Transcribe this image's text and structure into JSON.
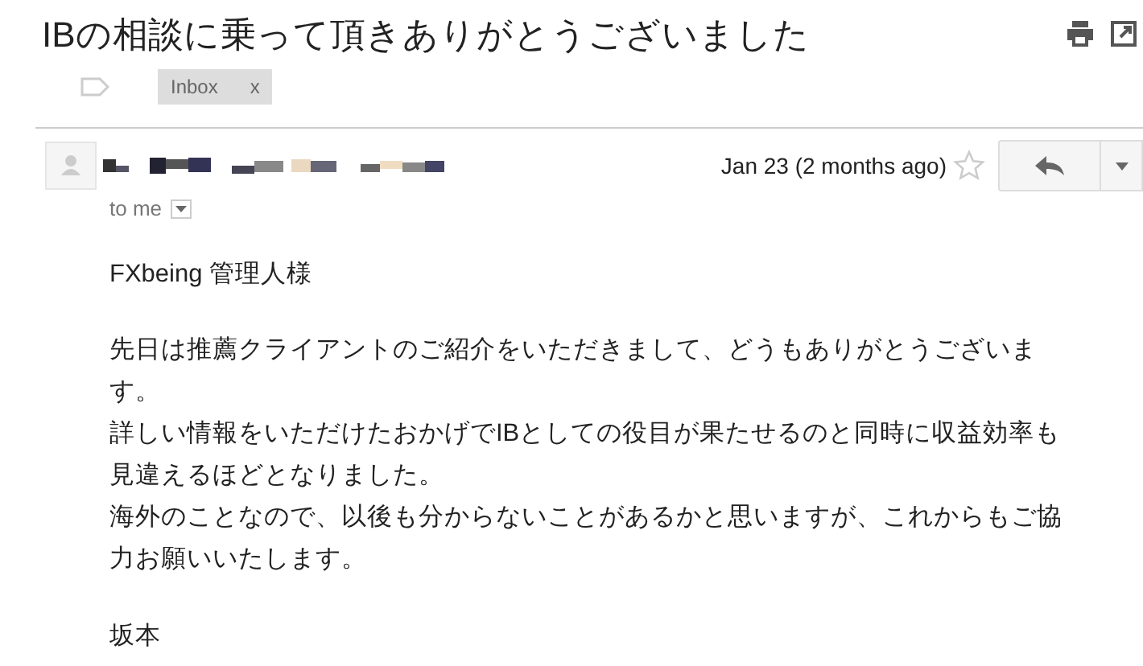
{
  "subject": "IBの相談に乗って頂きありがとうございました",
  "labels": [
    {
      "name": "Inbox",
      "remove": "x"
    }
  ],
  "message": {
    "date": "Jan 23 (2 months ago)",
    "starred": false,
    "recipient": "to me",
    "greeting": "FXbeing 管理人様",
    "body_lines": [
      "先日は推薦クライアントのご紹介をいただきまして、どうもありがとうございま",
      "す。",
      "詳しい情報をいただけたおかげでIBとしての役目が果たせるのと同時に収益効率も",
      "見違えるほどとなりました。",
      "海外のことなので、以後も分からないことがあるかと思いますが、これからもご協",
      "力お願いいたします。"
    ],
    "signature": "坂本"
  }
}
